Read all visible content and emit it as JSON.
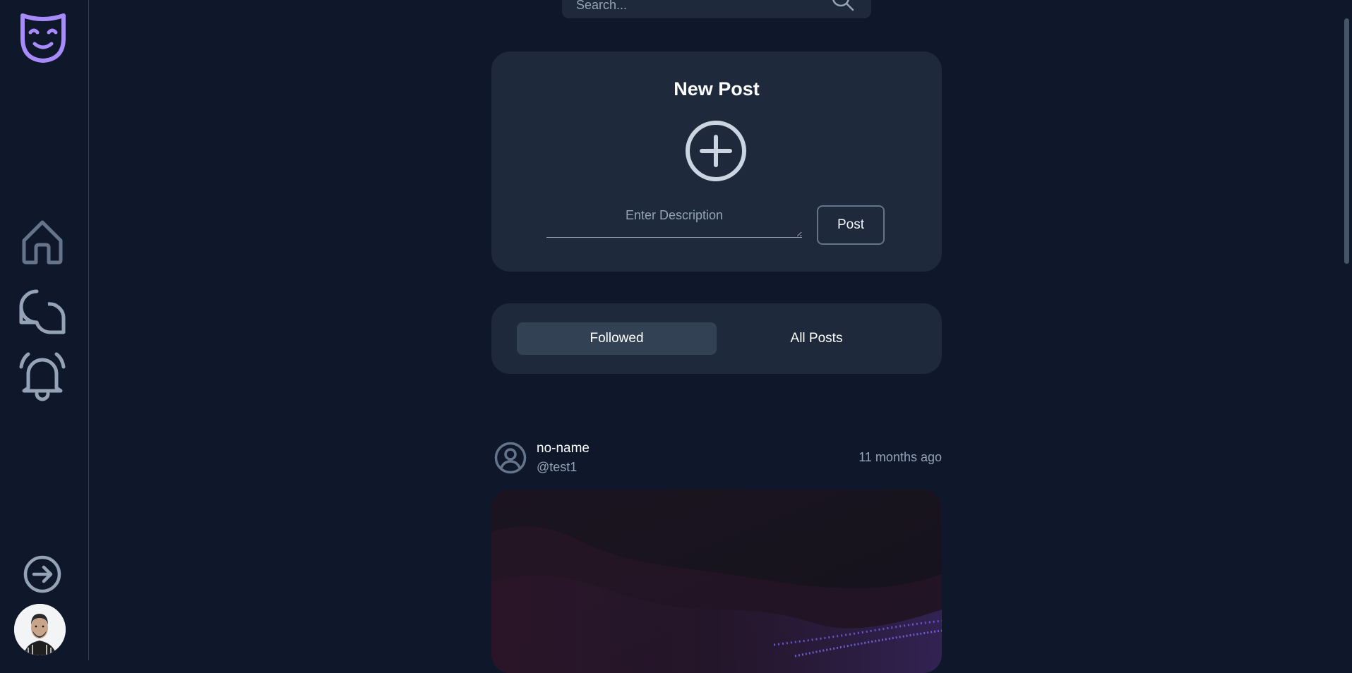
{
  "sidebar": {
    "logo_icon": "theater-mask-icon",
    "items": [
      {
        "icon": "home-icon"
      },
      {
        "icon": "chat-bubbles-icon"
      },
      {
        "icon": "bell-icon"
      }
    ],
    "logout_icon": "arrow-right-circle-icon",
    "avatar": "user-avatar"
  },
  "search": {
    "placeholder": "Search...",
    "icon": "search-icon"
  },
  "new_post": {
    "title": "New Post",
    "add_icon": "plus-circle-icon",
    "description_placeholder": "Enter Description",
    "post_label": "Post"
  },
  "feed_tabs": [
    {
      "label": "Followed",
      "active": true
    },
    {
      "label": "All Posts",
      "active": false
    }
  ],
  "post": {
    "name": "no-name",
    "handle": "@test1",
    "time": "11 months ago",
    "avatar_icon": "user-circle-icon"
  },
  "colors": {
    "background": "#0f172a",
    "card": "#1e293b",
    "active_tab": "#334155",
    "accent": "#a78bfa",
    "muted_text": "#94a3b8"
  }
}
